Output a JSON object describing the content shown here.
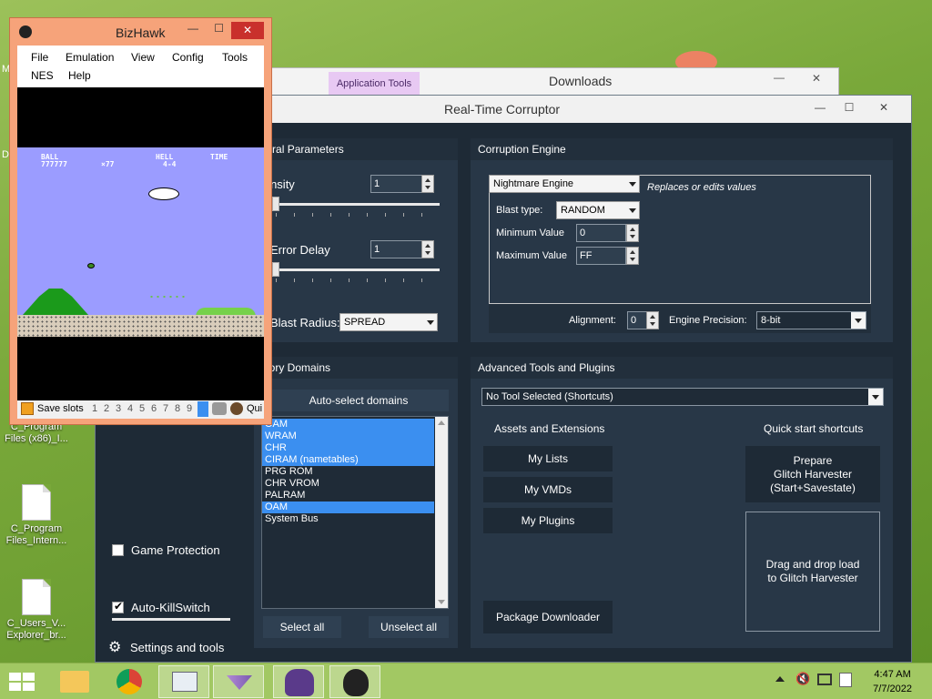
{
  "desktop": {
    "icons": [
      {
        "label": "C_Program Files (x86)_I..."
      },
      {
        "label": "C_Program Files_Intern..."
      },
      {
        "label": "C_Users_V... Explorer_br..."
      }
    ],
    "edge_letters": [
      "M",
      "D"
    ]
  },
  "downloads": {
    "title": "Downloads",
    "ribbon_tab": "Application Tools",
    "min_glyph": "—",
    "close_glyph": "✕"
  },
  "rtc": {
    "title": "Real-Time Corruptor",
    "min_glyph": "—",
    "max_glyph": "☐",
    "close_glyph": "✕",
    "general": {
      "header": "eneral Parameters",
      "intensity_label": "ntensity",
      "intensity_value": "1",
      "error_delay_label": "Error Delay",
      "error_delay_value": "1",
      "blast_radius_label": "Blast Radius:",
      "blast_radius_value": "SPREAD"
    },
    "engine": {
      "header": "Corruption Engine",
      "engine_value": "Nightmare Engine",
      "engine_description": "Replaces or edits values",
      "blast_type_label": "Blast type:",
      "blast_type_value": "RANDOM",
      "min_value_label": "Minimum Value",
      "min_value": "0",
      "max_value_label": "Maximum Value",
      "max_value": "FF",
      "alignment_label": "Alignment:",
      "alignment_value": "0",
      "precision_label": "Engine Precision:",
      "precision_value": "8-bit"
    },
    "domains": {
      "header": "emory Domains",
      "auto_select_label": "Auto-select domains",
      "items": [
        {
          "label": "OAM",
          "selected": true
        },
        {
          "label": "WRAM",
          "selected": true
        },
        {
          "label": "CHR",
          "selected": true
        },
        {
          "label": "CIRAM (nametables)",
          "selected": true
        },
        {
          "label": "PRG ROM",
          "selected": false
        },
        {
          "label": "CHR VROM",
          "selected": false
        },
        {
          "label": "PALRAM",
          "selected": false
        },
        {
          "label": "OAM",
          "selected": true
        },
        {
          "label": "System Bus",
          "selected": false
        }
      ],
      "select_all_label": "Select all",
      "unselect_all_label": "Unselect all"
    },
    "advanced": {
      "header": "Advanced Tools and Plugins",
      "tool_select_value": "No Tool Selected (Shortcuts)",
      "assets_label": "Assets and Extensions",
      "quick_label": "Quick start shortcuts",
      "my_lists": "My Lists",
      "my_vmds": "My VMDs",
      "my_plugins": "My Plugins",
      "package_downloader": "Package Downloader",
      "prepare_line1": "Prepare",
      "prepare_line2": "Glitch Harvester",
      "prepare_line3": "(Start+Savestate)",
      "drag_line1": "Drag and drop load",
      "drag_line2": "to Glitch Harvester"
    },
    "sidebar": {
      "game_protection": "Game Protection",
      "game_protection_checked": false,
      "auto_killswitch": "Auto-KillSwitch",
      "auto_killswitch_checked": true,
      "settings_label": "Settings and tools"
    }
  },
  "bizhawk": {
    "title": "BizHawk",
    "min_glyph": "—",
    "max_glyph": "☐",
    "close_glyph": "✕",
    "menu": [
      "File",
      "Emulation",
      "View",
      "Config",
      "Tools",
      "NES",
      "Help"
    ],
    "hud": {
      "ball": "BALL",
      "ball_dots": "777777",
      "mult": "×77",
      "hell": "HELL",
      "world": "4-4",
      "time": "TIME"
    },
    "status": {
      "save_slots": "Save slots",
      "slots": [
        "1",
        "2",
        "3",
        "4",
        "5",
        "6",
        "7",
        "8",
        "9"
      ],
      "tail": "Qui"
    }
  },
  "taskbar": {
    "time": "4:47 AM",
    "date": "7/7/2022"
  },
  "colors": {
    "rtc_bg": "#1e2a36",
    "panel_bg": "#283747",
    "selection": "#3b8ff0",
    "bizhawk_frame": "#f6a37a",
    "nes_sky": "#9b9cff"
  }
}
